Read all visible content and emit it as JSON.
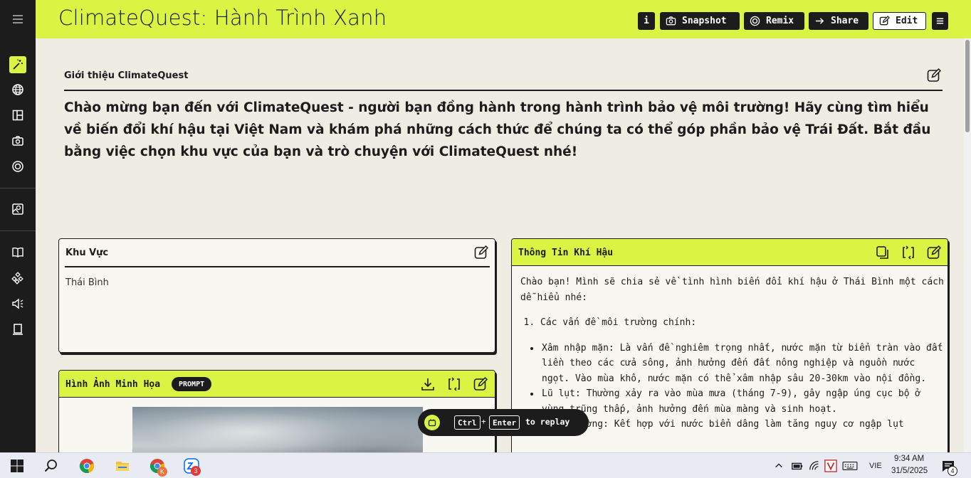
{
  "app": {
    "title": "ClimateQuest: Hành Trình Xanh"
  },
  "toolbar": {
    "info_label": "i",
    "snapshot_label": "Snapshot",
    "remix_label": "Remix",
    "share_label": "Share",
    "edit_label": "Edit"
  },
  "intro": {
    "label": "Giới thiệu ClimateQuest",
    "text": "Chào mừng bạn đến với ClimateQuest - người bạn đồng hành trong hành trình bảo vệ môi trường! Hãy cùng tìm hiểu về biến đổi khí hậu tại Việt Nam và khám phá những cách thức để chúng ta có thể góp phần bảo vệ Trái Đất. Bắt đầu bằng việc chọn khu vực của bạn và trò chuyện với ClimateQuest nhé!"
  },
  "region": {
    "label": "Khu Vực",
    "value": "Thái Bình"
  },
  "illustration": {
    "label": "Hình Ảnh Minh Họa",
    "badge": "PROMPT"
  },
  "climate": {
    "label": "Thông Tin Khí Hậu",
    "greeting": "Chào bạn! Mình sẽ chia sẻ về tình hình biến đổi khí hậu ở Thái Bình một cách dễ hiểu nhé:",
    "section_1": "Các vấn đề môi trường chính:",
    "bullets": [
      "Xâm nhập mặn: Là vấn đề nghiêm trọng nhất, nước mặn từ biển tràn vào đất liền theo các cửa sông, ảnh hưởng đến đất nông nghiệp và nguồn nước ngọt. Vào mùa khô, nước mặn có thể xâm nhập sâu 20-30km vào nội đồng.",
      "Lũ lụt: Thường xảy ra vào mùa mưa (tháng 7-9), gây ngập úng cục bộ ở vùng trũng thấp, ảnh hưởng đến mùa màng và sinh hoạt.",
      "Triều cường: Kết hợp với nước biển dâng làm tăng nguy cơ ngập lụt"
    ]
  },
  "replay": {
    "key_1": "Ctrl",
    "plus": "+",
    "key_2": "Enter",
    "text": "to replay"
  },
  "taskbar": {
    "language": "VIE",
    "time": "9:34 AM",
    "date": "31/5/2025",
    "chrome_badge": "K",
    "zalo_badge": "3",
    "notification_count": "4"
  },
  "colors": {
    "accent": "#d9f442",
    "dark": "#1c1c1c",
    "page_bg": "#efece3"
  }
}
